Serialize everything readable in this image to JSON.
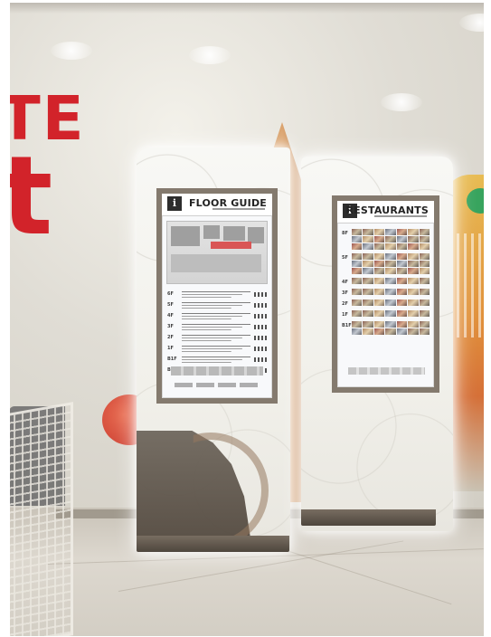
{
  "scene": {
    "type": "photograph",
    "description_kind": "illuminated mall directory signs"
  },
  "logo": {
    "partial_letters_top": "TE",
    "partial_letter_bottom": "t",
    "color": "#d2232a"
  },
  "signs": {
    "left": {
      "icon": "i",
      "title": "FLOOR GUIDE",
      "floors": [
        "6F",
        "5F",
        "4F",
        "3F",
        "2F",
        "1F",
        "B1F",
        "B2F"
      ]
    },
    "right": {
      "icon": "i",
      "title": "RESTAURANTS",
      "floors": [
        "8F",
        "5F",
        "4F",
        "3F",
        "2F",
        "1F",
        "B1F"
      ]
    }
  }
}
